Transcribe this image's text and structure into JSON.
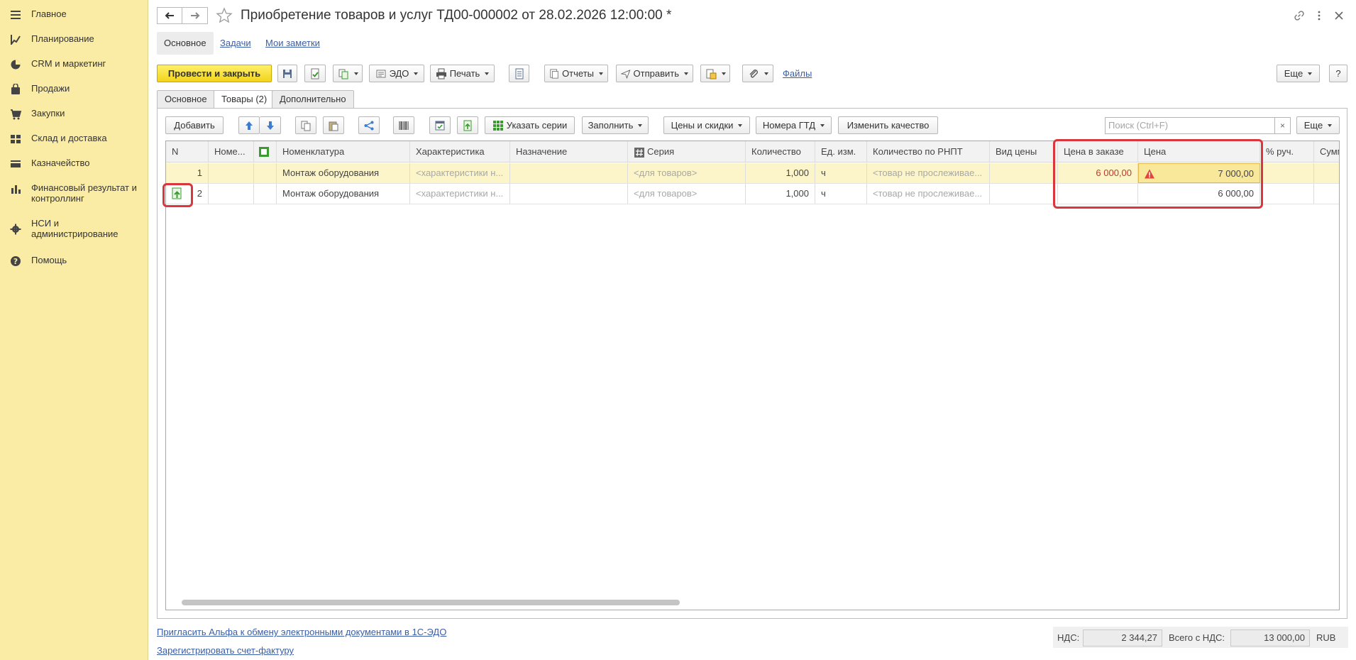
{
  "sidebar": {
    "items": [
      {
        "label": "Главное",
        "icon": "menu-icon"
      },
      {
        "label": "Планирование",
        "icon": "planning-icon"
      },
      {
        "label": "CRM и маркетинг",
        "icon": "pie-chart-icon"
      },
      {
        "label": "Продажи",
        "icon": "bag-icon"
      },
      {
        "label": "Закупки",
        "icon": "cart-icon"
      },
      {
        "label": "Склад и доставка",
        "icon": "warehouse-icon"
      },
      {
        "label": "Казначейство",
        "icon": "treasury-icon"
      },
      {
        "label": "Финансовый результат и контроллинг",
        "icon": "bar-chart-icon"
      },
      {
        "label": "НСИ и администрирование",
        "icon": "gear-icon"
      },
      {
        "label": "Помощь",
        "icon": "help-icon"
      }
    ]
  },
  "header": {
    "title": "Приобретение товаров и услуг ТД00-000002 от 28.02.2026 12:00:00 *"
  },
  "subnav": {
    "main": "Основное",
    "tasks": "Задачи",
    "notes": "Мои заметки"
  },
  "toolbar": {
    "post_close": "Провести и закрыть",
    "edo": "ЭДО",
    "print": "Печать",
    "reports": "Отчеты",
    "send": "Отправить",
    "files": "Файлы",
    "more": "Еще",
    "help": "?"
  },
  "tabs": [
    "Основное",
    "Товары (2)",
    "Дополнительно"
  ],
  "grid_toolbar": {
    "add": "Добавить",
    "series": "Указать серии",
    "fill": "Заполнить",
    "prices": "Цены и скидки",
    "gtd": "Номера ГТД",
    "quality": "Изменить качество",
    "search_placeholder": "Поиск (Ctrl+F)",
    "search_clear": "×",
    "more": "Еще"
  },
  "table": {
    "columns": [
      "N",
      "Номе...",
      "",
      "Номенклатура",
      "Характеристика",
      "Назначение",
      "Серия",
      "Количество",
      "Ед. изм.",
      "Количество по РНПТ",
      "Вид цены",
      "Цена в заказе",
      "Цена",
      "% руч.",
      "Сумм"
    ],
    "rows": [
      {
        "n": "1",
        "nomenclature": "Монтаж оборудования",
        "characteristic": "<характеристики н...",
        "purpose": "",
        "series": "<для товаров>",
        "qty": "1,000",
        "unit": "ч",
        "rnpt": "<товар не прослеживае...",
        "price_type": "",
        "order_price": "6 000,00",
        "price": "7 000,00"
      },
      {
        "n": "2",
        "nomenclature": "Монтаж оборудования",
        "characteristic": "<характеристики н...",
        "purpose": "",
        "series": "<для товаров>",
        "qty": "1,000",
        "unit": "ч",
        "rnpt": "<товар не прослеживае...",
        "price_type": "",
        "order_price": "",
        "price": "6 000,00"
      }
    ]
  },
  "footer": {
    "invite": "Пригласить Альфа к обмену электронными документами в 1С-ЭДО",
    "register": "Зарегистрировать счет-фактуру",
    "vat_label": "НДС:",
    "vat_value": "2 344,27",
    "total_label": "Всего с НДС:",
    "total_value": "13 000,00",
    "currency": "RUB"
  }
}
